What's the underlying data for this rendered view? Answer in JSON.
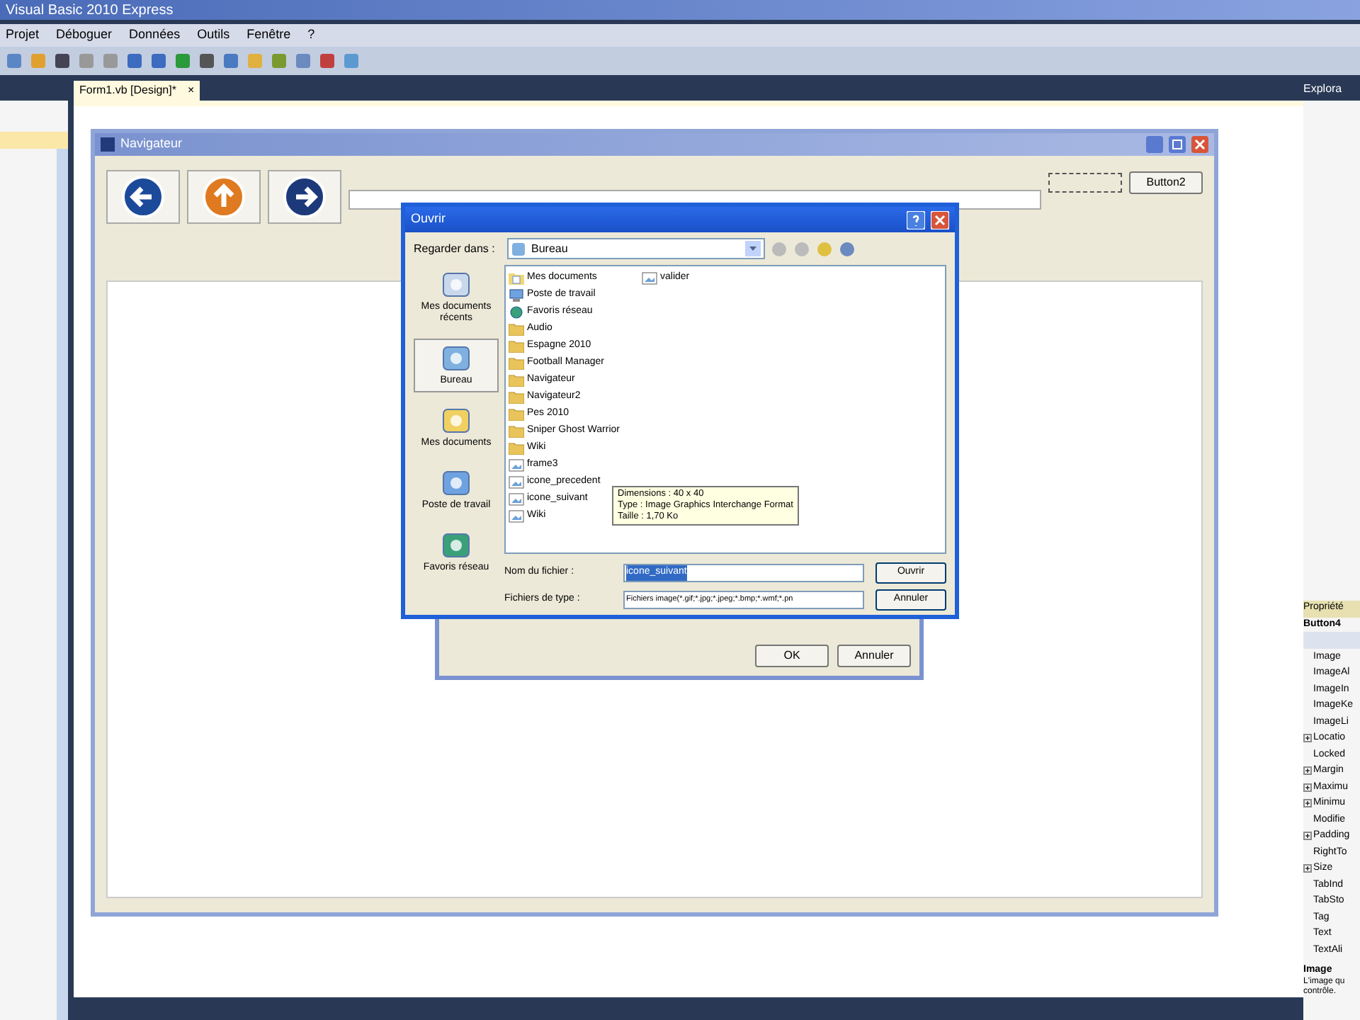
{
  "window": {
    "title": "Visual Basic 2010 Express"
  },
  "menu": [
    "Projet",
    "Déboguer",
    "Données",
    "Outils",
    "Fenêtre",
    "?"
  ],
  "doc_tab": {
    "label": "Form1.vb [Design]*",
    "close": "×"
  },
  "form": {
    "title": "Navigateur",
    "button": "Button2"
  },
  "back_dialog": {
    "buttons": [
      "OK",
      "Annuler"
    ]
  },
  "open_dialog": {
    "title": "Ouvrir",
    "look_in_label": "Regarder dans :",
    "look_in": "Bureau",
    "places": [
      {
        "label": "Mes documents récents",
        "selected": false
      },
      {
        "label": "Bureau",
        "selected": true
      },
      {
        "label": "Mes documents",
        "selected": false
      },
      {
        "label": "Poste de travail",
        "selected": false
      },
      {
        "label": "Favoris réseau",
        "selected": false
      }
    ],
    "files": [
      {
        "name": "Mes documents",
        "kind": "docs"
      },
      {
        "name": "Poste de travail",
        "kind": "computer"
      },
      {
        "name": "Favoris réseau",
        "kind": "network"
      },
      {
        "name": "Audio",
        "kind": "folder"
      },
      {
        "name": "Espagne 2010",
        "kind": "folder"
      },
      {
        "name": "Football Manager",
        "kind": "folder"
      },
      {
        "name": "Navigateur",
        "kind": "folder"
      },
      {
        "name": "Navigateur2",
        "kind": "folder"
      },
      {
        "name": "Pes 2010",
        "kind": "folder"
      },
      {
        "name": "Sniper Ghost Warrior",
        "kind": "folder"
      },
      {
        "name": "Wiki",
        "kind": "folder"
      },
      {
        "name": "frame3",
        "kind": "image"
      },
      {
        "name": "icone_precedent",
        "kind": "image"
      },
      {
        "name": "icone_suivant",
        "kind": "image"
      },
      {
        "name": "Wiki",
        "kind": "image"
      },
      {
        "name": "valider",
        "kind": "image"
      }
    ],
    "tooltip": [
      "Dimensions : 40 x 40",
      "Type : Image Graphics Interchange Format",
      "Taille : 1,70 Ko"
    ],
    "file_name_label": "Nom du fichier :",
    "file_name": "icone_suivant",
    "file_type_label": "Fichiers de type :",
    "file_type": "Fichiers image(*.gif;*.jpg;*.jpeg;*.bmp;*.wmf;*.pn",
    "buttons": [
      "Ouvrir",
      "Annuler"
    ]
  },
  "explorer": {
    "title": "Explora"
  },
  "properties": {
    "title": "Propriété",
    "object": "Button4",
    "rows": [
      {
        "label": "Image",
        "expandable": false
      },
      {
        "label": "ImageAl",
        "expandable": false
      },
      {
        "label": "ImageIn",
        "expandable": false
      },
      {
        "label": "ImageKe",
        "expandable": false
      },
      {
        "label": "ImageLi",
        "expandable": false
      },
      {
        "label": "Locatio",
        "expandable": true
      },
      {
        "label": "Locked",
        "expandable": false
      },
      {
        "label": "Margin",
        "expandable": true
      },
      {
        "label": "Maximu",
        "expandable": true
      },
      {
        "label": "Minimu",
        "expandable": true
      },
      {
        "label": "Modifie",
        "expandable": false
      },
      {
        "label": "Padding",
        "expandable": true
      },
      {
        "label": "RightTo",
        "expandable": false
      },
      {
        "label": "Size",
        "expandable": true
      },
      {
        "label": "TabInd",
        "expandable": false
      },
      {
        "label": "TabSto",
        "expandable": false
      },
      {
        "label": "Tag",
        "expandable": false
      },
      {
        "label": "Text",
        "expandable": false
      },
      {
        "label": "TextAli",
        "expandable": false
      }
    ],
    "desc_title": "Image",
    "desc": "L'image qu contrôle."
  }
}
